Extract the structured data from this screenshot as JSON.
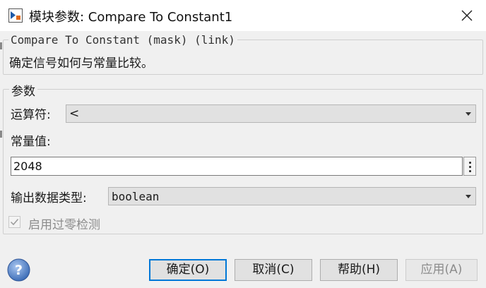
{
  "window": {
    "title": "模块参数: Compare To Constant1"
  },
  "description_group": {
    "title": "Compare To Constant (mask) (link)",
    "text": "确定信号如何与常量比较。"
  },
  "params_group": {
    "title": "参数",
    "operator": {
      "label": "运算符:",
      "value": "<"
    },
    "constant": {
      "label": "常量值:",
      "value": "2048"
    },
    "output_type": {
      "label": "输出数据类型:",
      "value": "boolean"
    },
    "zero_crossing": {
      "label": "启用过零检测",
      "checked": true,
      "enabled": false
    }
  },
  "buttons": {
    "ok": "确定(O)",
    "cancel": "取消(C)",
    "help": "帮助(H)",
    "apply": "应用(A)"
  },
  "icons": {
    "app": "simulink-block-icon",
    "close": "close-icon",
    "help": "help-question-icon",
    "dropdown": "chevron-down-icon",
    "more": "more-vertical-icon"
  },
  "colors": {
    "primary_border": "#0078d7",
    "help_icon": "#3f6fb8"
  }
}
